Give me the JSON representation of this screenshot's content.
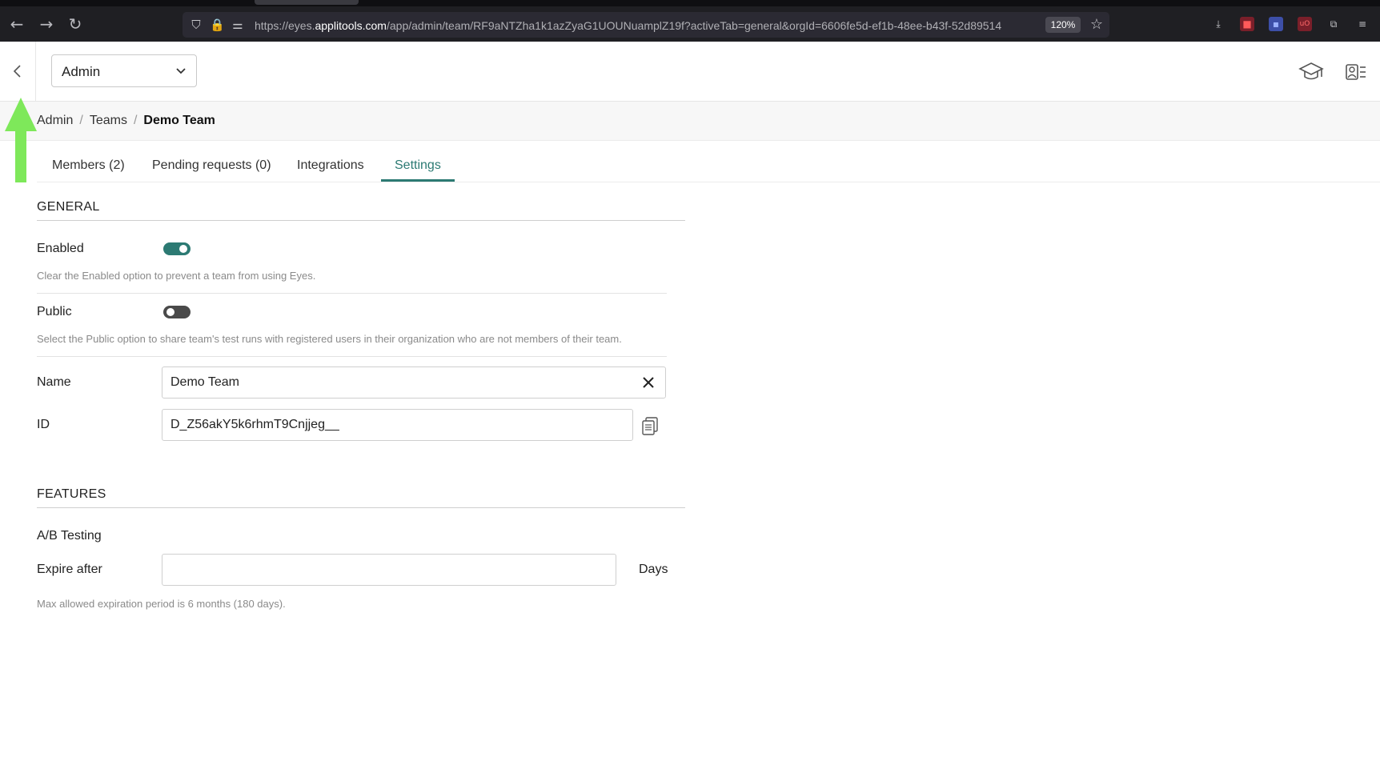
{
  "browser": {
    "url_prefix": "https://eyes.",
    "url_host": "applitools.com",
    "url_rest": "/app/admin/team/RF9aNTZha1k1azZyaG1UOUNuamplZ19f?activeTab=general&orgId=6606fe5d-ef1b-48ee-b43f-52d89514",
    "zoom": "120%"
  },
  "header": {
    "account_select": "Admin"
  },
  "breadcrumb": {
    "items": [
      "Admin",
      "Teams"
    ],
    "current": "Demo Team",
    "separator": "/"
  },
  "tabs": [
    {
      "label": "Members (2)"
    },
    {
      "label": "Pending requests (0)"
    },
    {
      "label": "Integrations"
    },
    {
      "label": "Settings",
      "active": true
    }
  ],
  "general": {
    "title": "GENERAL",
    "enabled": {
      "label": "Enabled",
      "state": true,
      "help": "Clear the Enabled option to prevent a team from using Eyes."
    },
    "public": {
      "label": "Public",
      "state": false,
      "help": "Select the Public option to share team's test runs with registered users in their organization who are not members of their team."
    },
    "name": {
      "label": "Name",
      "value": "Demo Team"
    },
    "id": {
      "label": "ID",
      "value": "D_Z56akY5k6rhmT9Cnjjeg__"
    }
  },
  "features": {
    "title": "FEATURES",
    "ab_testing": "A/B Testing",
    "expire_after": {
      "label": "Expire after",
      "value": "",
      "units": "Days",
      "help": "Max allowed expiration period is 6 months (180 days)."
    }
  },
  "colors": {
    "accent": "#2c7a73",
    "arrow": "#7ee85a"
  }
}
